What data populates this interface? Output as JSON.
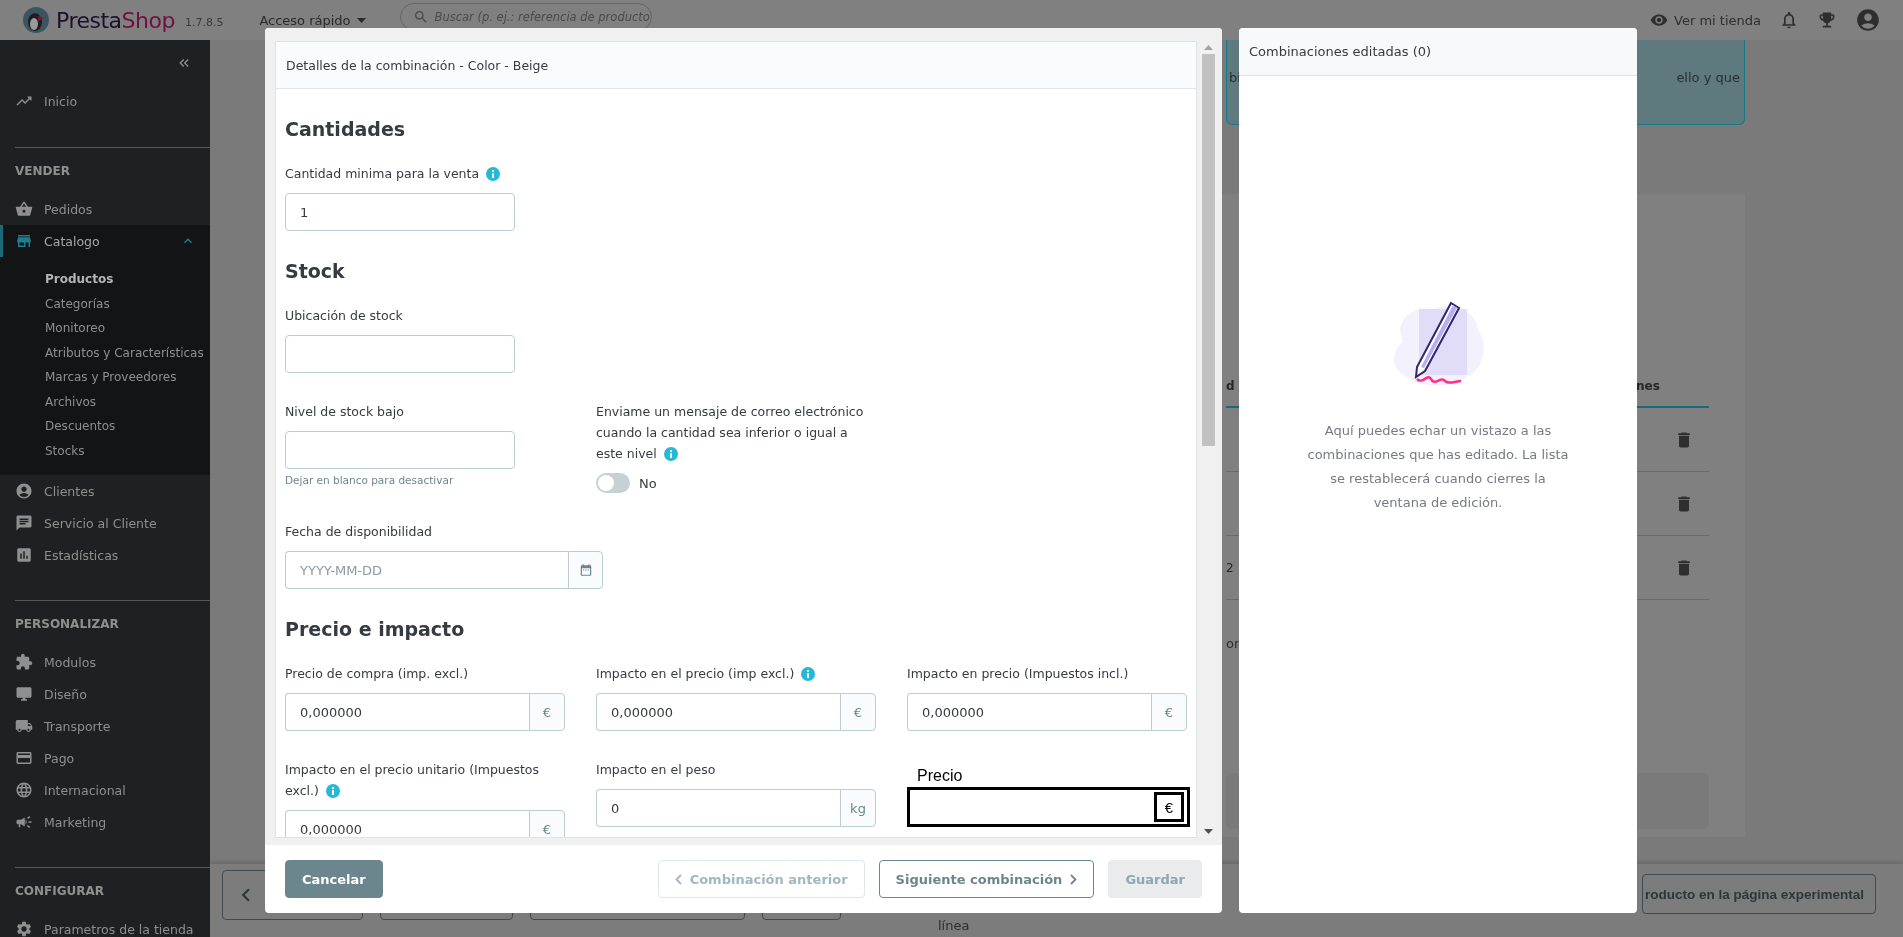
{
  "header": {
    "logo": [
      "Presta",
      "Shop"
    ],
    "version": "1.7.8.5",
    "quick_access": "Acceso rápido",
    "search_placeholder": "Buscar (p. ej.: referencia de producto",
    "view_store": "Ver mi tienda"
  },
  "sidebar": {
    "groups": [
      {
        "items": [
          {
            "label": "Inicio",
            "selected": false
          }
        ]
      },
      {
        "title": "VENDER",
        "items": [
          {
            "label": "Pedidos",
            "selected": false
          },
          {
            "label": "Catalogo",
            "selected": true,
            "expanded": true,
            "children": [
              {
                "label": "Productos",
                "selected": true
              },
              {
                "label": "Categorías",
                "selected": false
              },
              {
                "label": "Monitoreo",
                "selected": false
              },
              {
                "label": "Atributos y Características",
                "selected": false
              },
              {
                "label": "Marcas y Proveedores",
                "selected": false
              },
              {
                "label": "Archivos",
                "selected": false
              },
              {
                "label": "Descuentos",
                "selected": false
              },
              {
                "label": "Stocks",
                "selected": false
              }
            ]
          },
          {
            "label": "Clientes",
            "selected": false
          },
          {
            "label": "Servicio al Cliente",
            "selected": false
          },
          {
            "label": "Estadísticas",
            "selected": false
          }
        ]
      },
      {
        "title": "PERSONALIZAR",
        "items": [
          {
            "label": "Modulos",
            "selected": false
          },
          {
            "label": "Diseño",
            "selected": false
          },
          {
            "label": "Transporte",
            "selected": false
          },
          {
            "label": "Pago",
            "selected": false
          },
          {
            "label": "Internacional",
            "selected": false
          },
          {
            "label": "Marketing",
            "selected": false
          }
        ]
      },
      {
        "title": "CONFIGURAR",
        "items": [
          {
            "label": "Parametros de la tienda",
            "selected": false
          }
        ]
      }
    ]
  },
  "background": {
    "alert": {
      "left_fragment": "bi",
      "right_fragment": "ello y que"
    },
    "table": {
      "left_header": "d",
      "right_header": "nes",
      "rows": [
        {
          "delete": true
        },
        {
          "delete": true
        },
        {
          "fragment": "2",
          "delete": true
        }
      ]
    },
    "note_fragment": "or",
    "bottom_bar": {
      "buttons": [
        {
          "kind": "back"
        },
        {
          "kind": "plain"
        },
        {
          "kind": "plain"
        },
        {
          "kind": "plain"
        }
      ],
      "fragment": "línea",
      "preview_button": "roducto en la página experimental"
    }
  },
  "modal": {
    "title": "Detalles de la combinación - Color - Beige",
    "sections": [
      {
        "heading": "Cantidades",
        "rows": [
          [
            {
              "kind": "input",
              "label": "Cantidad minima para la venta",
              "info": true,
              "value": "1"
            }
          ]
        ]
      },
      {
        "heading": "Stock",
        "rows": [
          [
            {
              "kind": "input",
              "label": "Ubicación de stock"
            }
          ],
          [
            {
              "kind": "input",
              "label": "Nivel de stock bajo",
              "help": "Dejar en blanco para desactivar"
            },
            {
              "kind": "toggle",
              "label": "Enviame un mensaje de correo electrónico cuando la cantidad sea inferior o igual a este nivel",
              "info": true,
              "on": false,
              "state_text": "No"
            }
          ],
          [
            {
              "kind": "date",
              "label": "Fecha de disponibilidad",
              "placeholder": "YYYY-MM-DD"
            }
          ]
        ]
      },
      {
        "heading": "Precio e impacto",
        "rows": [
          [
            {
              "kind": "addon",
              "label": "Precio de compra (imp. excl.)",
              "value": "0,000000",
              "addon": "€"
            },
            {
              "kind": "addon",
              "label": "Impacto en el precio (imp excl.)",
              "info": true,
              "value": "0,000000",
              "addon": "€"
            },
            {
              "kind": "addon",
              "label": "Impacto en precio (Impuestos incl.)",
              "value": "0,000000",
              "addon": "€"
            }
          ],
          [
            {
              "kind": "addon",
              "label": "Impacto en el precio unitario (Impuestos excl.)",
              "info": true,
              "value": "0,000000",
              "addon": "€"
            },
            {
              "kind": "addon",
              "label": "Impacto en el peso",
              "value": "0",
              "addon": "kg"
            },
            {
              "kind": "plain",
              "label": "Precio",
              "addon": "€"
            }
          ]
        ]
      }
    ],
    "buttons": [
      {
        "kind": "secondary",
        "label": "Cancelar",
        "disabled": false
      },
      {
        "kind": "prev",
        "label": "Combinación anterior",
        "disabled": true
      },
      {
        "kind": "next",
        "label": "Siguiente combinación",
        "disabled": false
      },
      {
        "kind": "primary",
        "label": "Guardar",
        "disabled": true
      }
    ]
  },
  "edited_panel": {
    "title": "Combinaciones editadas (0)",
    "message": "Aquí puedes echar un vistazo a las combinaciones que has editado. La lista se restablecerá cuando cierres la ventana de edición."
  }
}
